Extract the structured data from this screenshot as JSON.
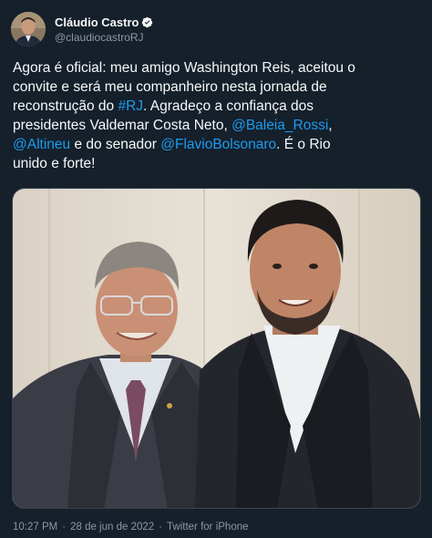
{
  "author": {
    "display_name": "Cláudio Castro",
    "handle": "@claudiocastroRJ",
    "verified": true
  },
  "tweet": {
    "lines": [
      [
        {
          "t": "Agora é oficial: meu amigo Washington Reis, aceitou o",
          "link": false
        }
      ],
      [
        {
          "t": "convite e será meu companheiro nesta jornada de",
          "link": false
        }
      ],
      [
        {
          "t": "reconstrução do ",
          "link": false
        },
        {
          "t": "#RJ",
          "link": true
        },
        {
          "t": ". Agradeço a confiança dos",
          "link": false
        }
      ],
      [
        {
          "t": "presidentes Valdemar  Costa Neto, ",
          "link": false
        },
        {
          "t": "@Baleia_Rossi",
          "link": true
        },
        {
          "t": ",",
          "link": false
        }
      ],
      [
        {
          "t": "@Altineu",
          "link": true
        },
        {
          "t": " e do senador ",
          "link": false
        },
        {
          "t": "@FlavioBolsonaro",
          "link": true
        },
        {
          "t": ". É o Rio",
          "link": false
        }
      ],
      [
        {
          "t": "unido e forte!",
          "link": false
        }
      ]
    ]
  },
  "meta": {
    "time": "10:27 PM",
    "date": "28 de jun de 2022",
    "source": "Twitter for iPhone",
    "separator": "·"
  },
  "colors": {
    "background": "#15202b",
    "text": "#f7f9f9",
    "muted": "#8b98a5",
    "link": "#1d9bf0"
  }
}
